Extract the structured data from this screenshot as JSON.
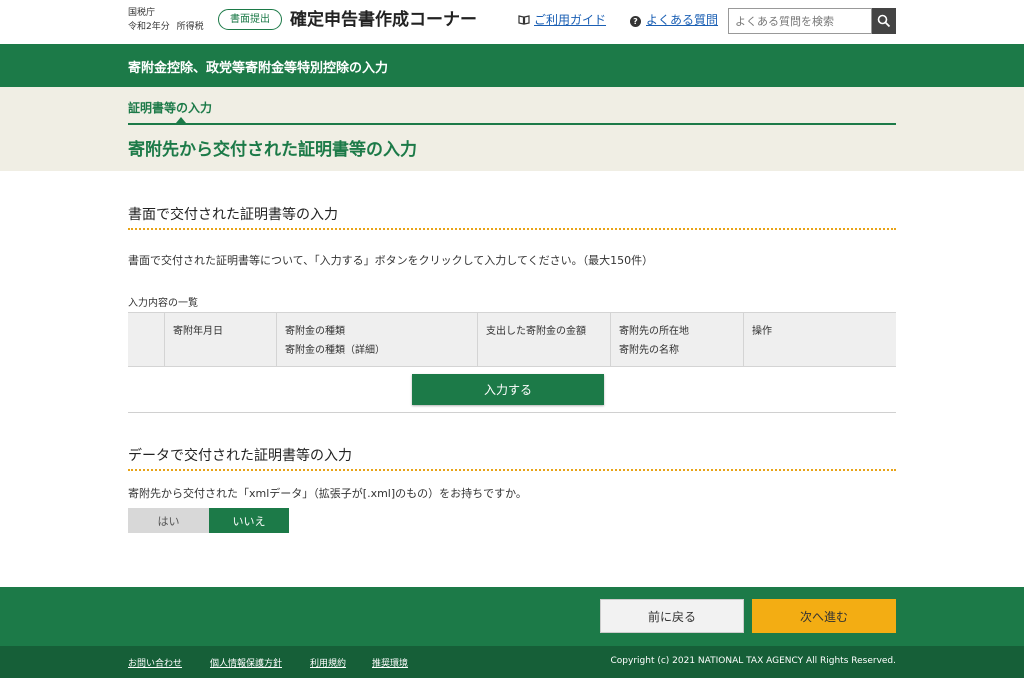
{
  "header": {
    "agency_name": "国税庁",
    "year": "令和2年分",
    "tax_type": "所得税",
    "badge": "書面提出",
    "app_title": "確定申告書作成コーナー",
    "guide_link": "ご利用ガイド",
    "faq_link": "よくある質問",
    "search_placeholder": "よくある質問を検索"
  },
  "section_title": "寄附金控除、政党等寄附金等特別控除の入力",
  "step": {
    "label": "証明書等の入力",
    "page_title": "寄附先から交付された証明書等の入力"
  },
  "paper_section": {
    "heading": "書面で交付された証明書等の入力",
    "description": "書面で交付された証明書等について、「入力する」ボタンをクリックして入力してください。（最大150件）",
    "table_caption": "入力内容の一覧",
    "columns": [
      {
        "line1": "",
        "line2": ""
      },
      {
        "line1": "寄附年月日",
        "line2": ""
      },
      {
        "line1": "寄附金の種類",
        "line2": "寄附金の種類（詳細）"
      },
      {
        "line1": "支出した寄附金の金額",
        "line2": ""
      },
      {
        "line1": "寄附先の所在地",
        "line2": "寄附先の名称"
      },
      {
        "line1": "操作",
        "line2": ""
      }
    ],
    "input_button": "入力する"
  },
  "data_section": {
    "heading": "データで交付された証明書等の入力",
    "question": "寄附先から交付された「xmlデータ」（拡張子が[.xml]のもの）をお持ちですか。",
    "yes_label": "はい",
    "no_label": "いいえ",
    "selected": "いいえ"
  },
  "footer": {
    "back_button": "前に戻る",
    "next_button": "次へ進む",
    "links": [
      "お問い合わせ",
      "個人情報保護方針",
      "利用規約",
      "推奨環境"
    ],
    "copyright": "Copyright (c) 2021 NATIONAL TAX AGENCY All Rights Reserved."
  },
  "colors": {
    "brand_green": "#1c7a48",
    "dark_green": "#165f38",
    "accent_orange": "#f3ad13",
    "beige": "#f0eee4",
    "link_blue": "#1a5fb4"
  }
}
